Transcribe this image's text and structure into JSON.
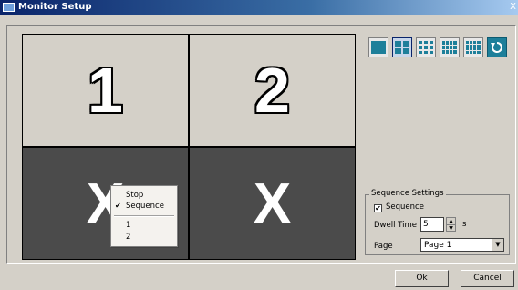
{
  "window": {
    "title": "Monitor Setup",
    "close_label": "X"
  },
  "grid": {
    "cells": [
      {
        "label": "1",
        "state": "assigned"
      },
      {
        "label": "2",
        "state": "assigned"
      },
      {
        "label": "X",
        "state": "empty"
      },
      {
        "label": "X",
        "state": "empty"
      }
    ]
  },
  "layout_buttons": [
    {
      "icon": "layout-1x1-icon",
      "active": false
    },
    {
      "icon": "layout-2x2-icon",
      "active": true
    },
    {
      "icon": "layout-3x3-icon",
      "active": false
    },
    {
      "icon": "layout-4x3-icon",
      "active": false
    },
    {
      "icon": "layout-4x4-icon",
      "active": false
    },
    {
      "icon": "refresh-icon",
      "active": false
    }
  ],
  "context_menu": {
    "items": [
      {
        "label": "Stop",
        "checked": false
      },
      {
        "label": "Sequence",
        "checked": true
      },
      {
        "label": "1",
        "checked": false
      },
      {
        "label": "2",
        "checked": false
      }
    ]
  },
  "sequence_settings": {
    "legend": "Sequence Settings",
    "sequence_label": "Sequence",
    "sequence_checked": true,
    "dwell_label": "Dwell Time",
    "dwell_value": "5",
    "dwell_unit": "s",
    "page_label": "Page",
    "page_value": "Page 1"
  },
  "buttons": {
    "ok": "Ok",
    "cancel": "Cancel"
  },
  "colors": {
    "title_bar": "#0a246a",
    "dialog_bg": "#d4d0c8",
    "dark_cell": "#4b4b4b",
    "accent": "#1d7f9a"
  }
}
